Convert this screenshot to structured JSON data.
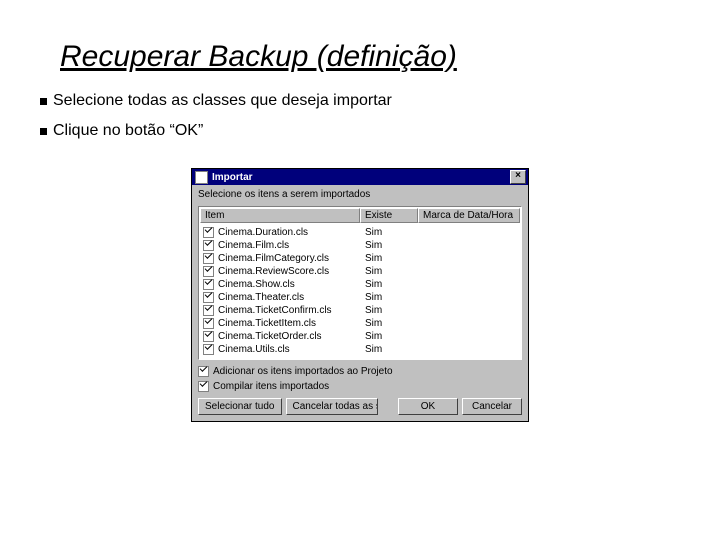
{
  "title": "Recuperar Backup (definição)",
  "bullets": {
    "b1": "Selecione todas as classes que deseja importar",
    "b2": "Clique no botão “OK”"
  },
  "dialog": {
    "window_title": "Importar",
    "close_glyph": "×",
    "subtitle": "Selecione os itens a serem importados",
    "columns": {
      "item": "Item",
      "exists": "Existe",
      "ts": "Marca de Data/Hora"
    },
    "rows": [
      {
        "name": "Cinema.Duration.cls",
        "exists": "Sim"
      },
      {
        "name": "Cinema.Film.cls",
        "exists": "Sim"
      },
      {
        "name": "Cinema.FilmCategory.cls",
        "exists": "Sim"
      },
      {
        "name": "Cinema.ReviewScore.cls",
        "exists": "Sim"
      },
      {
        "name": "Cinema.Show.cls",
        "exists": "Sim"
      },
      {
        "name": "Cinema.Theater.cls",
        "exists": "Sim"
      },
      {
        "name": "Cinema.TicketConfirm.cls",
        "exists": "Sim"
      },
      {
        "name": "Cinema.TicketItem.cls",
        "exists": "Sim"
      },
      {
        "name": "Cinema.TicketOrder.cls",
        "exists": "Sim"
      },
      {
        "name": "Cinema.Utils.cls",
        "exists": "Sim"
      }
    ],
    "check_add": "Adicionar os itens importados ao Projeto",
    "check_compile": "Compilar itens importados",
    "btn_select_all": "Selecionar tudo",
    "btn_deselect_all": "Cancelar todas as seleções",
    "btn_ok": "OK",
    "btn_cancel": "Cancelar"
  }
}
